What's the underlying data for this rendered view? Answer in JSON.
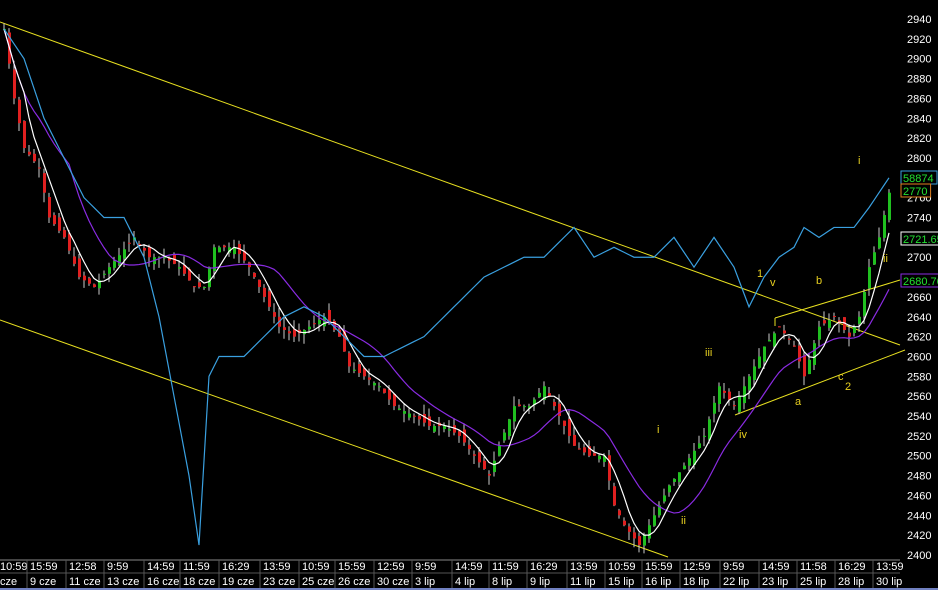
{
  "chart_data": {
    "type": "candlestick",
    "title": "",
    "ylim": [
      2400,
      2940
    ],
    "yticks": [
      2400,
      2420,
      2440,
      2460,
      2480,
      2500,
      2520,
      2540,
      2560,
      2580,
      2600,
      2620,
      2640,
      2660,
      2680,
      2700,
      2720,
      2740,
      2760,
      2780,
      2800,
      2820,
      2840,
      2860,
      2880,
      2900,
      2920,
      2940
    ],
    "xtick_times": [
      "10:59",
      "15:59",
      "12:58",
      "9:59",
      "14:59",
      "11:59",
      "16:29",
      "13:59",
      "10:59",
      "15:59",
      "12:59",
      "9:59",
      "14:59",
      "11:59",
      "16:29",
      "13:59",
      "10:59",
      "15:59",
      "12:59",
      "9:59",
      "14:59",
      "11:58",
      "16:29",
      "13:59"
    ],
    "xtick_dates": [
      "cze",
      "9 cze",
      "11 cze",
      "13 cze",
      "16 cze",
      "18 cze",
      "19 cze",
      "23 cze",
      "25 cze",
      "26 cze",
      "30 cze",
      "3 lip",
      "4 lip",
      "8 lip",
      "9 lip",
      "11 lip",
      "15 lip",
      "16 lip",
      "18 lip",
      "22 lip",
      "23 lip",
      "25 lip",
      "28 lip",
      "30 lip"
    ],
    "price_path": [
      [
        0,
        2930
      ],
      [
        2,
        2860
      ],
      [
        4,
        2810
      ],
      [
        7,
        2790
      ],
      [
        9,
        2740
      ],
      [
        12,
        2720
      ],
      [
        15,
        2680
      ],
      [
        18,
        2670
      ],
      [
        21,
        2690
      ],
      [
        26,
        2720
      ],
      [
        29,
        2700
      ],
      [
        32,
        2700
      ],
      [
        35,
        2690
      ],
      [
        38,
        2670
      ],
      [
        40,
        2670
      ],
      [
        42,
        2710
      ],
      [
        46,
        2710
      ],
      [
        49,
        2690
      ],
      [
        52,
        2660
      ],
      [
        55,
        2630
      ],
      [
        58,
        2620
      ],
      [
        61,
        2630
      ],
      [
        64,
        2640
      ],
      [
        67,
        2620
      ],
      [
        69,
        2590
      ],
      [
        72,
        2580
      ],
      [
        75,
        2570
      ],
      [
        78,
        2550
      ],
      [
        82,
        2540
      ],
      [
        85,
        2530
      ],
      [
        88,
        2530
      ],
      [
        91,
        2520
      ],
      [
        94,
        2500
      ],
      [
        97,
        2480
      ],
      [
        99,
        2510
      ],
      [
        102,
        2550
      ],
      [
        105,
        2550
      ],
      [
        108,
        2570
      ],
      [
        111,
        2540
      ],
      [
        114,
        2510
      ],
      [
        117,
        2500
      ],
      [
        120,
        2500
      ],
      [
        122,
        2450
      ],
      [
        124,
        2430
      ],
      [
        127,
        2410
      ],
      [
        130,
        2440
      ],
      [
        133,
        2470
      ],
      [
        136,
        2490
      ],
      [
        140,
        2520
      ],
      [
        143,
        2570
      ],
      [
        146,
        2550
      ],
      [
        149,
        2580
      ],
      [
        152,
        2610
      ],
      [
        155,
        2630
      ],
      [
        158,
        2610
      ],
      [
        160,
        2580
      ],
      [
        163,
        2630
      ],
      [
        166,
        2640
      ],
      [
        169,
        2620
      ],
      [
        171,
        2640
      ],
      [
        173,
        2690
      ],
      [
        175,
        2720
      ],
      [
        177,
        2765
      ]
    ],
    "indicator_path": [
      [
        0,
        2930
      ],
      [
        4,
        2900
      ],
      [
        8,
        2840
      ],
      [
        12,
        2800
      ],
      [
        16,
        2760
      ],
      [
        20,
        2740
      ],
      [
        24,
        2740
      ],
      [
        28,
        2700
      ],
      [
        31,
        2640
      ],
      [
        34,
        2560
      ],
      [
        37,
        2480
      ],
      [
        39,
        2410
      ],
      [
        41,
        2580
      ],
      [
        43,
        2600
      ],
      [
        48,
        2600
      ],
      [
        52,
        2620
      ],
      [
        56,
        2640
      ],
      [
        60,
        2650
      ],
      [
        64,
        2640
      ],
      [
        68,
        2620
      ],
      [
        72,
        2600
      ],
      [
        76,
        2600
      ],
      [
        80,
        2610
      ],
      [
        84,
        2620
      ],
      [
        88,
        2640
      ],
      [
        92,
        2660
      ],
      [
        96,
        2680
      ],
      [
        100,
        2690
      ],
      [
        104,
        2700
      ],
      [
        108,
        2700
      ],
      [
        112,
        2720
      ],
      [
        114,
        2730
      ],
      [
        118,
        2700
      ],
      [
        122,
        2710
      ],
      [
        126,
        2700
      ],
      [
        130,
        2700
      ],
      [
        134,
        2720
      ],
      [
        138,
        2690
      ],
      [
        142,
        2720
      ],
      [
        146,
        2690
      ],
      [
        149,
        2650
      ],
      [
        152,
        2680
      ],
      [
        155,
        2700
      ],
      [
        158,
        2710
      ],
      [
        160,
        2730
      ],
      [
        163,
        2720
      ],
      [
        166,
        2730
      ],
      [
        170,
        2730
      ],
      [
        173,
        2750
      ],
      [
        177,
        2780
      ]
    ],
    "value_tags": {
      "indicator": "58874",
      "last": "2770",
      "ma_fast": "2721.65",
      "ma_slow": "2680.76"
    },
    "wave_labels": [
      "i",
      "1",
      "v",
      "b",
      "iii",
      "ii",
      "i",
      "iv",
      "a",
      "c",
      "2",
      "ii"
    ],
    "colors": {
      "up": "#20c020",
      "down": "#e02020",
      "indicator": "#3aa0e0",
      "ma_fast": "#ffffff",
      "ma_slow": "#8a2be2",
      "trend": "#e8e020"
    }
  }
}
